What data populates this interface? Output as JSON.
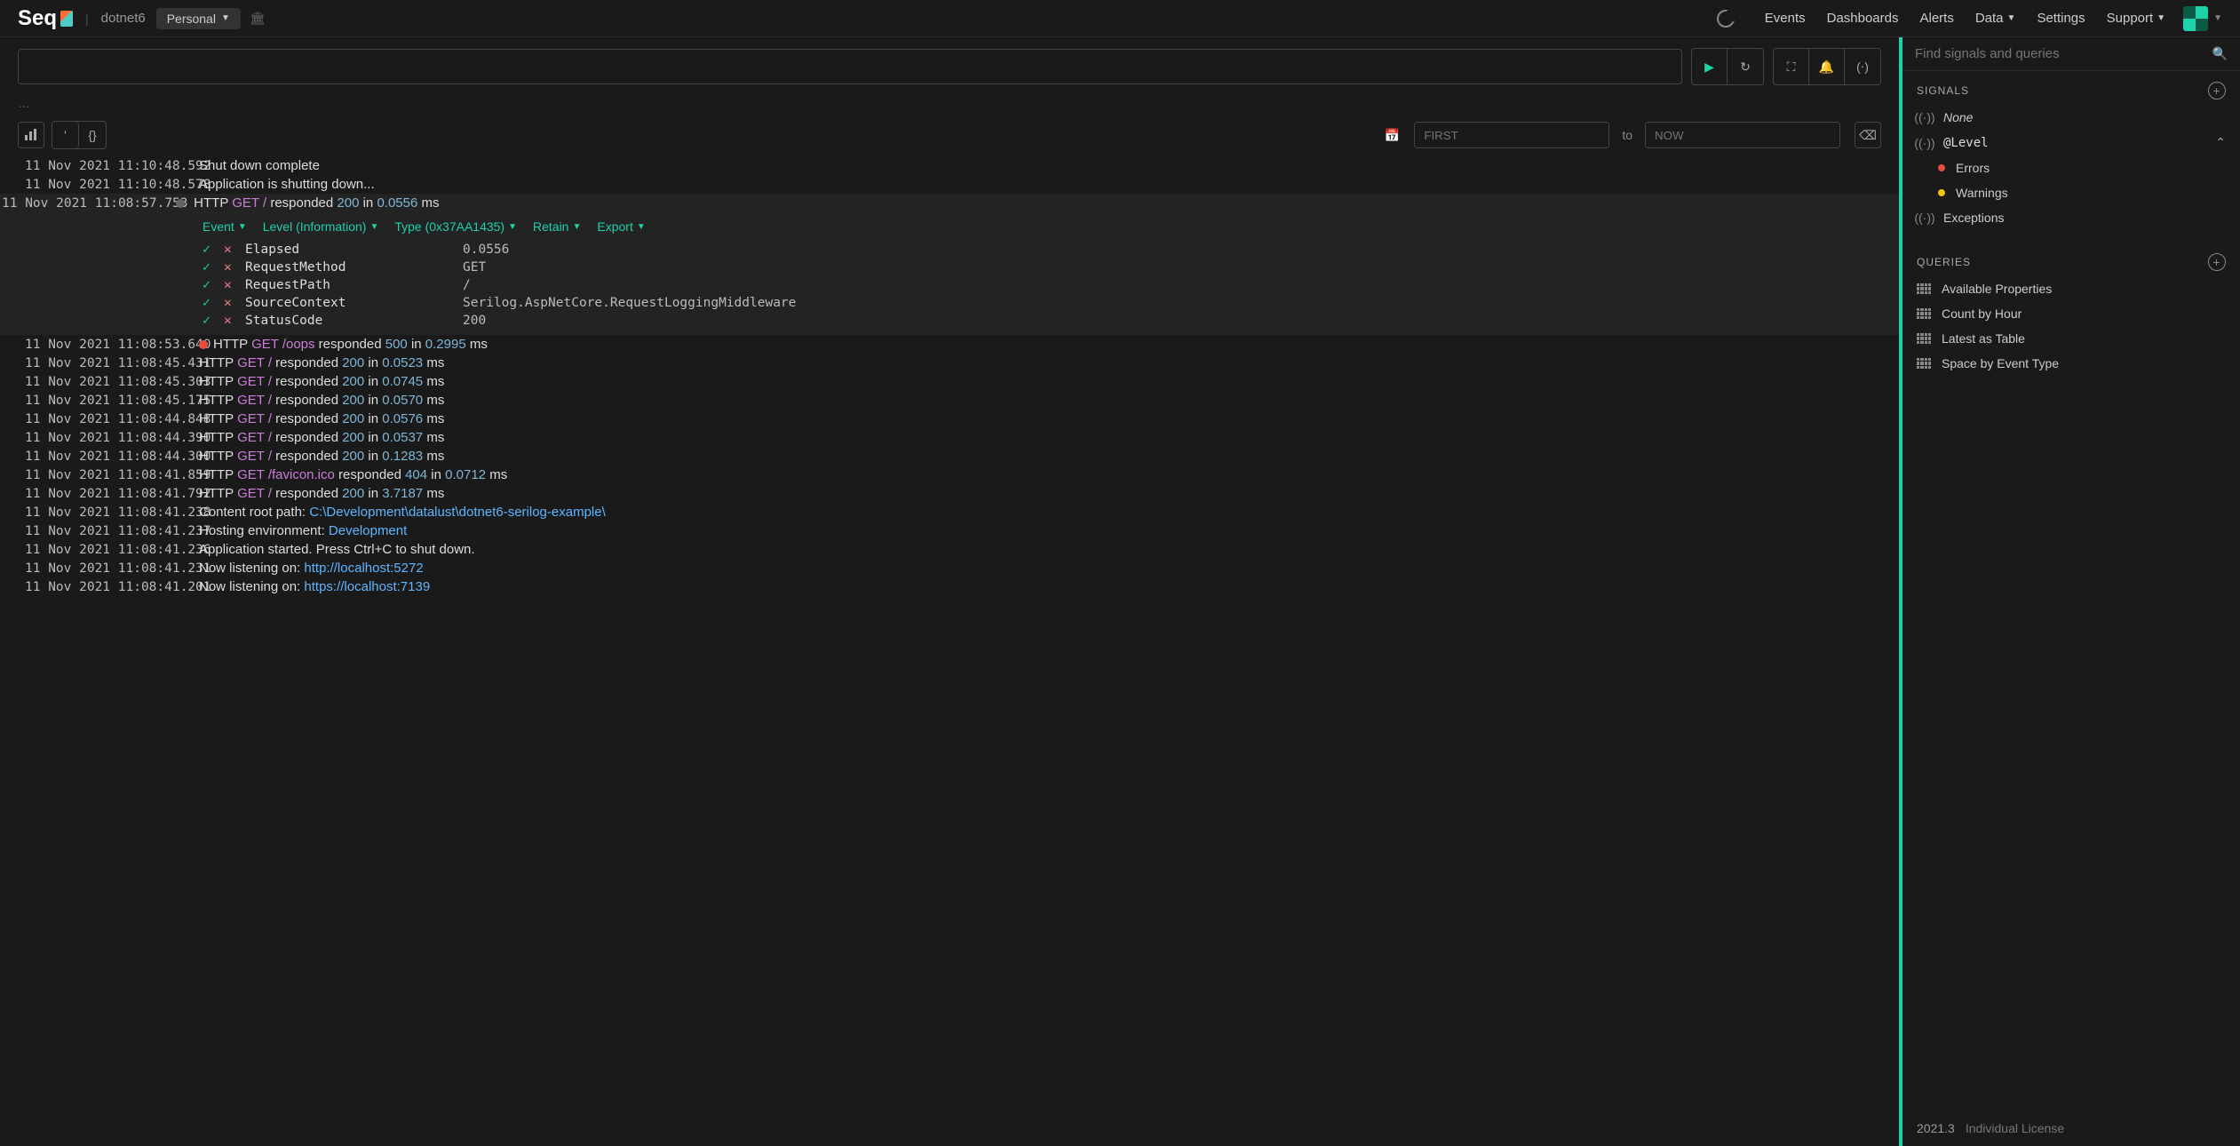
{
  "header": {
    "logo": "Seq",
    "breadcrumb": "dotnet6",
    "workspace": "Personal",
    "nav": [
      "Events",
      "Dashboards",
      "Alerts",
      "Data",
      "Settings",
      "Support"
    ]
  },
  "query": {
    "placeholder": "",
    "ellipsis": "…",
    "from_placeholder": "FIRST",
    "to_label": "to",
    "to_placeholder": "NOW"
  },
  "expanded": {
    "actions": {
      "event": "Event",
      "level": "Level (Information)",
      "type": "Type (0x37AA1435)",
      "retain": "Retain",
      "export": "Export"
    },
    "props": [
      {
        "k": "Elapsed",
        "v": "0.0556"
      },
      {
        "k": "RequestMethod",
        "v": "GET"
      },
      {
        "k": "RequestPath",
        "v": "/"
      },
      {
        "k": "SourceContext",
        "v": "Serilog.AspNetCore.RequestLoggingMiddleware"
      },
      {
        "k": "StatusCode",
        "v": "200"
      }
    ]
  },
  "events": [
    {
      "ts": "11 Nov 2021 11:10:48.592",
      "plain": "Shut down complete"
    },
    {
      "ts": "11 Nov 2021 11:10:48.578",
      "plain": "Application is shutting down..."
    },
    {
      "ts": "11 Nov 2021 11:08:57.753",
      "http": true,
      "dot": "gray",
      "method": "GET",
      "path": "/",
      "code": "200",
      "elapsed": "0.0556",
      "expanded": true
    },
    {
      "ts": "11 Nov 2021 11:08:53.640",
      "http": true,
      "dot": "red",
      "method": "GET",
      "path": "/oops",
      "code": "500",
      "elapsed": "0.2995"
    },
    {
      "ts": "11 Nov 2021 11:08:45.431",
      "http": true,
      "method": "GET",
      "path": "/",
      "code": "200",
      "elapsed": "0.0523"
    },
    {
      "ts": "11 Nov 2021 11:08:45.303",
      "http": true,
      "method": "GET",
      "path": "/",
      "code": "200",
      "elapsed": "0.0745"
    },
    {
      "ts": "11 Nov 2021 11:08:45.175",
      "http": true,
      "method": "GET",
      "path": "/",
      "code": "200",
      "elapsed": "0.0570"
    },
    {
      "ts": "11 Nov 2021 11:08:44.848",
      "http": true,
      "method": "GET",
      "path": "/",
      "code": "200",
      "elapsed": "0.0576"
    },
    {
      "ts": "11 Nov 2021 11:08:44.390",
      "http": true,
      "method": "GET",
      "path": "/",
      "code": "200",
      "elapsed": "0.0537"
    },
    {
      "ts": "11 Nov 2021 11:08:44.300",
      "http": true,
      "method": "GET",
      "path": "/",
      "code": "200",
      "elapsed": "0.1283"
    },
    {
      "ts": "11 Nov 2021 11:08:41.859",
      "http": true,
      "method": "GET",
      "path": "/favicon.ico",
      "code": "404",
      "elapsed": "0.0712"
    },
    {
      "ts": "11 Nov 2021 11:08:41.792",
      "http": true,
      "method": "GET",
      "path": "/",
      "code": "200",
      "elapsed": "3.7187"
    },
    {
      "ts": "11 Nov 2021 11:08:41.238",
      "prefix": "Content root path: ",
      "highlight": "C:\\Development\\datalust\\dotnet6-serilog-example\\"
    },
    {
      "ts": "11 Nov 2021 11:08:41.237",
      "prefix": "Hosting environment: ",
      "highlight": "Development"
    },
    {
      "ts": "11 Nov 2021 11:08:41.236",
      "plain": "Application started. Press Ctrl+C to shut down."
    },
    {
      "ts": "11 Nov 2021 11:08:41.231",
      "prefix": "Now listening on: ",
      "highlight": "http://localhost:5272"
    },
    {
      "ts": "11 Nov 2021 11:08:41.201",
      "prefix": "Now listening on: ",
      "highlight": "https://localhost:7139"
    }
  ],
  "sidebar": {
    "search_placeholder": "Find signals and queries",
    "signals_header": "SIGNALS",
    "queries_header": "QUERIES",
    "signals": {
      "none": "None",
      "level": "@Level",
      "errors": "Errors",
      "warnings": "Warnings",
      "exceptions": "Exceptions"
    },
    "queries": [
      "Available Properties",
      "Count by Hour",
      "Latest as Table",
      "Space by Event Type"
    ],
    "version": "2021.3",
    "license": "Individual License"
  }
}
